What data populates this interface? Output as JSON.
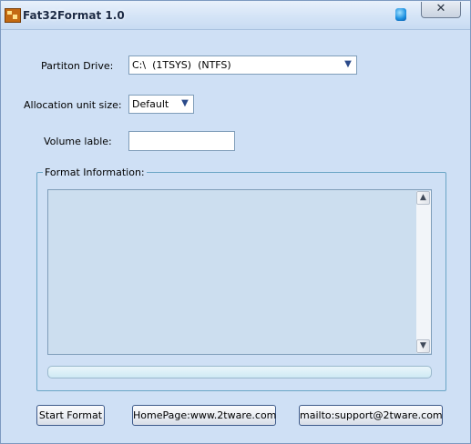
{
  "window": {
    "title": "Fat32Format 1.0",
    "close_glyph": "✕"
  },
  "form": {
    "partition_label": "Partiton Drive:",
    "partition_value": "C:\\  (1TSYS)  (NTFS)",
    "allocation_label": "Allocation unit size:",
    "allocation_value": "Default",
    "volume_label": "Volume lable:",
    "volume_value": ""
  },
  "format_info": {
    "legend": "Format Information:",
    "text": "",
    "progress_fraction": 0
  },
  "buttons": {
    "start": "Start Format",
    "homepage": "HomePage:www.2tware.com",
    "mailto": "mailto:support@2tware.com"
  },
  "icons": {
    "app": "app-icon",
    "pin": "pin-icon",
    "close": "close-icon",
    "combo_arrow": "chevron-down-icon",
    "scroll_up": "arrow-up-icon",
    "scroll_down": "arrow-down-icon"
  },
  "colors": {
    "window_bg": "#cfe0f5",
    "group_border": "#6aa5c6",
    "button_border": "#3d5a8a"
  }
}
